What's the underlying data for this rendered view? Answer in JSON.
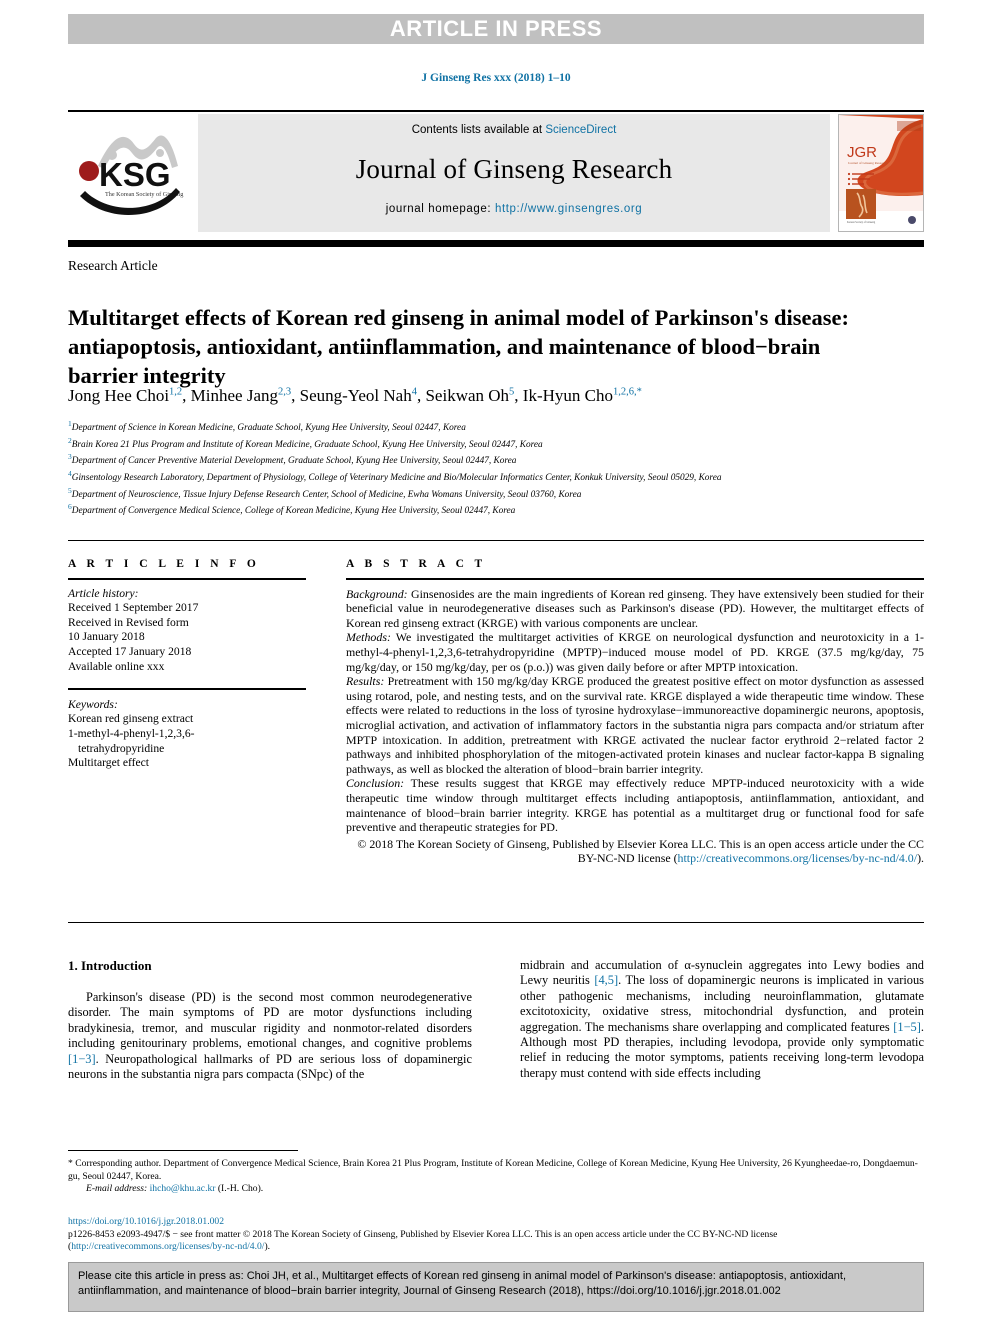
{
  "banner": {
    "text": "ARTICLE IN PRESS"
  },
  "journal_ref": "J Ginseng Res xxx (2018) 1–10",
  "masthead": {
    "contents_prefix": "Contents lists available at ",
    "contents_link": "ScienceDirect",
    "journal_title": "Journal of Ginseng Research",
    "homepage_prefix": "journal homepage: ",
    "homepage_url": "http://www.ginsengres.org",
    "logo_text": "KSG",
    "logo_subtext": "The Korean Society of Ginseng",
    "cover_text": "JGR",
    "cover_sub": "Journal of Ginseng Research"
  },
  "article_type": "Research Article",
  "title": "Multitarget effects of Korean red ginseng in animal model of Parkinson's disease: antiapoptosis, antioxidant, antiinflammation, and maintenance of blood−brain barrier integrity",
  "authors": [
    {
      "name": "Jong Hee Choi",
      "sup": "1,2",
      "sep": ", "
    },
    {
      "name": "Minhee Jang",
      "sup": "2,3",
      "sep": ", "
    },
    {
      "name": "Seung-Yeol Nah",
      "sup": "4",
      "sep": ", "
    },
    {
      "name": "Seikwan Oh",
      "sup": "5",
      "sep": ", "
    },
    {
      "name": "Ik-Hyun Cho",
      "sup": "1,2,6,*",
      "sep": ""
    }
  ],
  "affiliations": [
    {
      "sup": "1",
      "text": "Department of Science in Korean Medicine, Graduate School, Kyung Hee University, Seoul 02447, Korea"
    },
    {
      "sup": "2",
      "text": "Brain Korea 21 Plus Program and Institute of Korean Medicine, Graduate School, Kyung Hee University, Seoul 02447, Korea"
    },
    {
      "sup": "3",
      "text": "Department of Cancer Preventive Material Development, Graduate School, Kyung Hee University, Seoul 02447, Korea"
    },
    {
      "sup": "4",
      "text": "Ginsentology Research Laboratory, Department of Physiology, College of Veterinary Medicine and Bio/Molecular Informatics Center, Konkuk University, Seoul 05029, Korea"
    },
    {
      "sup": "5",
      "text": "Department of Neuroscience, Tissue Injury Defense Research Center, School of Medicine, Ewha Womans University, Seoul 03760, Korea"
    },
    {
      "sup": "6",
      "text": "Department of Convergence Medical Science, College of Korean Medicine, Kyung Hee University, Seoul 02447, Korea"
    }
  ],
  "article_info": {
    "heading": "A R T I C L E   I N F O",
    "history_label": "Article history:",
    "history": [
      "Received 1 September 2017",
      "Received in Revised form",
      "10 January 2018",
      "Accepted 17 January 2018",
      "Available online xxx"
    ],
    "keywords_label": "Keywords:",
    "keywords": [
      "Korean red ginseng extract",
      "1-methyl-4-phenyl-1,2,3,6-",
      "tetrahydropyridine",
      "Multitarget effect"
    ]
  },
  "abstract": {
    "heading": "A B S T R A C T",
    "background_label": "Background:",
    "background": " Ginsenosides are the main ingredients of Korean red ginseng. They have extensively been studied for their beneficial value in neurodegenerative diseases such as Parkinson's disease (PD). However, the multitarget effects of Korean red ginseng extract (KRGE) with various components are unclear.",
    "methods_label": "Methods:",
    "methods": " We investigated the multitarget activities of KRGE on neurological dysfunction and neurotoxicity in a 1-methyl-4-phenyl-1,2,3,6-tetrahydropyridine (MPTP)−induced mouse model of PD. KRGE (37.5 mg/kg/day, 75 mg/kg/day, or 150 mg/kg/day, per os (p.o.)) was given daily before or after MPTP intoxication.",
    "results_label": "Results:",
    "results": " Pretreatment with 150 mg/kg/day KRGE produced the greatest positive effect on motor dysfunction as assessed using rotarod, pole, and nesting tests, and on the survival rate. KRGE displayed a wide therapeutic time window. These effects were related to reductions in the loss of tyrosine hydroxylase−immunoreactive dopaminergic neurons, apoptosis, microglial activation, and activation of inflammatory factors in the substantia nigra pars compacta and/or striatum after MPTP intoxication. In addition, pretreatment with KRGE activated the nuclear factor erythroid 2−related factor 2 pathways and inhibited phosphorylation of the mitogen-activated protein kinases and nuclear factor-kappa B signaling pathways, as well as blocked the alteration of blood−brain barrier integrity.",
    "conclusion_label": "Conclusion:",
    "conclusion": " These results suggest that KRGE may effectively reduce MPTP-induced neurotoxicity with a wide therapeutic time window through multitarget effects including antiapoptosis, antiinflammation, antioxidant, and maintenance of blood−brain barrier integrity. KRGE has potential as a multitarget drug or functional food for safe preventive and therapeutic strategies for PD.",
    "copyright_1": "© 2018 The Korean Society of Ginseng, Published by Elsevier Korea LLC. This is an open access article under the CC BY-NC-ND license (",
    "copyright_link": "http://creativecommons.org/licenses/by-nc-nd/4.0/",
    "copyright_2": ")."
  },
  "intro": {
    "heading": "1. Introduction",
    "left_p1_a": "Parkinson's disease (PD) is the second most common neurodegenerative disorder. The main symptoms of PD are motor dysfunctions including bradykinesia, tremor, and muscular rigidity and nonmotor-related disorders including genitourinary problems, emotional changes, and cognitive problems ",
    "ref_1_3": "[1−3]",
    "left_p1_b": ". Neuropathological hallmarks of PD are serious loss of dopaminergic neurons in the substantia nigra pars compacta (SNpc) of the",
    "right_p1_a": "midbrain and accumulation of α-synuclein aggregates into Lewy bodies and Lewy neuritis ",
    "ref_4_5": "[4,5]",
    "right_p1_b": ". The loss of dopaminergic neurons is implicated in various other pathogenic mechanisms, including neuroinflammation, glutamate excitotoxicity, oxidative stress, mitochondrial dysfunction, and protein aggregation. The mechanisms share overlapping and complicated features ",
    "ref_1_5": "[1−5]",
    "right_p1_c": ". Although most PD therapies, including levodopa, provide only symptomatic relief in reducing the motor symptoms, patients receiving long-term levodopa therapy must contend with side effects including"
  },
  "footnote": {
    "corresponding": "* Corresponding author. Department of Convergence Medical Science, Brain Korea 21 Plus Program, Institute of Korean Medicine, College of Korean Medicine, Kyung Hee University, 26 Kyungheedae-ro, Dongdaemun-gu, Seoul 02447, Korea.",
    "email_label": "E-mail address:",
    "email": "ihcho@khu.ac.kr",
    "email_suffix": " (I.-H. Cho)."
  },
  "doi_block": {
    "doi": "https://doi.org/10.1016/j.jgr.2018.01.002",
    "issn_line": "p1226-8453 e2093-4947/$ − see front matter © 2018 The Korean Society of Ginseng, Published by Elsevier Korea LLC. This is an open access article under the CC BY-NC-ND license (",
    "license_link": "http://creativecommons.org/licenses/by-nc-nd/4.0/",
    "issn_tail": ")."
  },
  "cite_box": {
    "text": "Please cite this article in press as: Choi JH, et al., Multitarget effects of Korean red ginseng in animal model of Parkinson's disease: antiapoptosis, antioxidant, antiinflammation, and maintenance of blood−brain barrier integrity, Journal of Ginseng Research (2018), https://doi.org/10.1016/j.jgr.2018.01.002"
  },
  "colors": {
    "link": "#1072a4",
    "banner_bg": "#c0c0c0",
    "masthead_bg": "#e8e8e8",
    "cite_bg": "#c9c9c9"
  }
}
